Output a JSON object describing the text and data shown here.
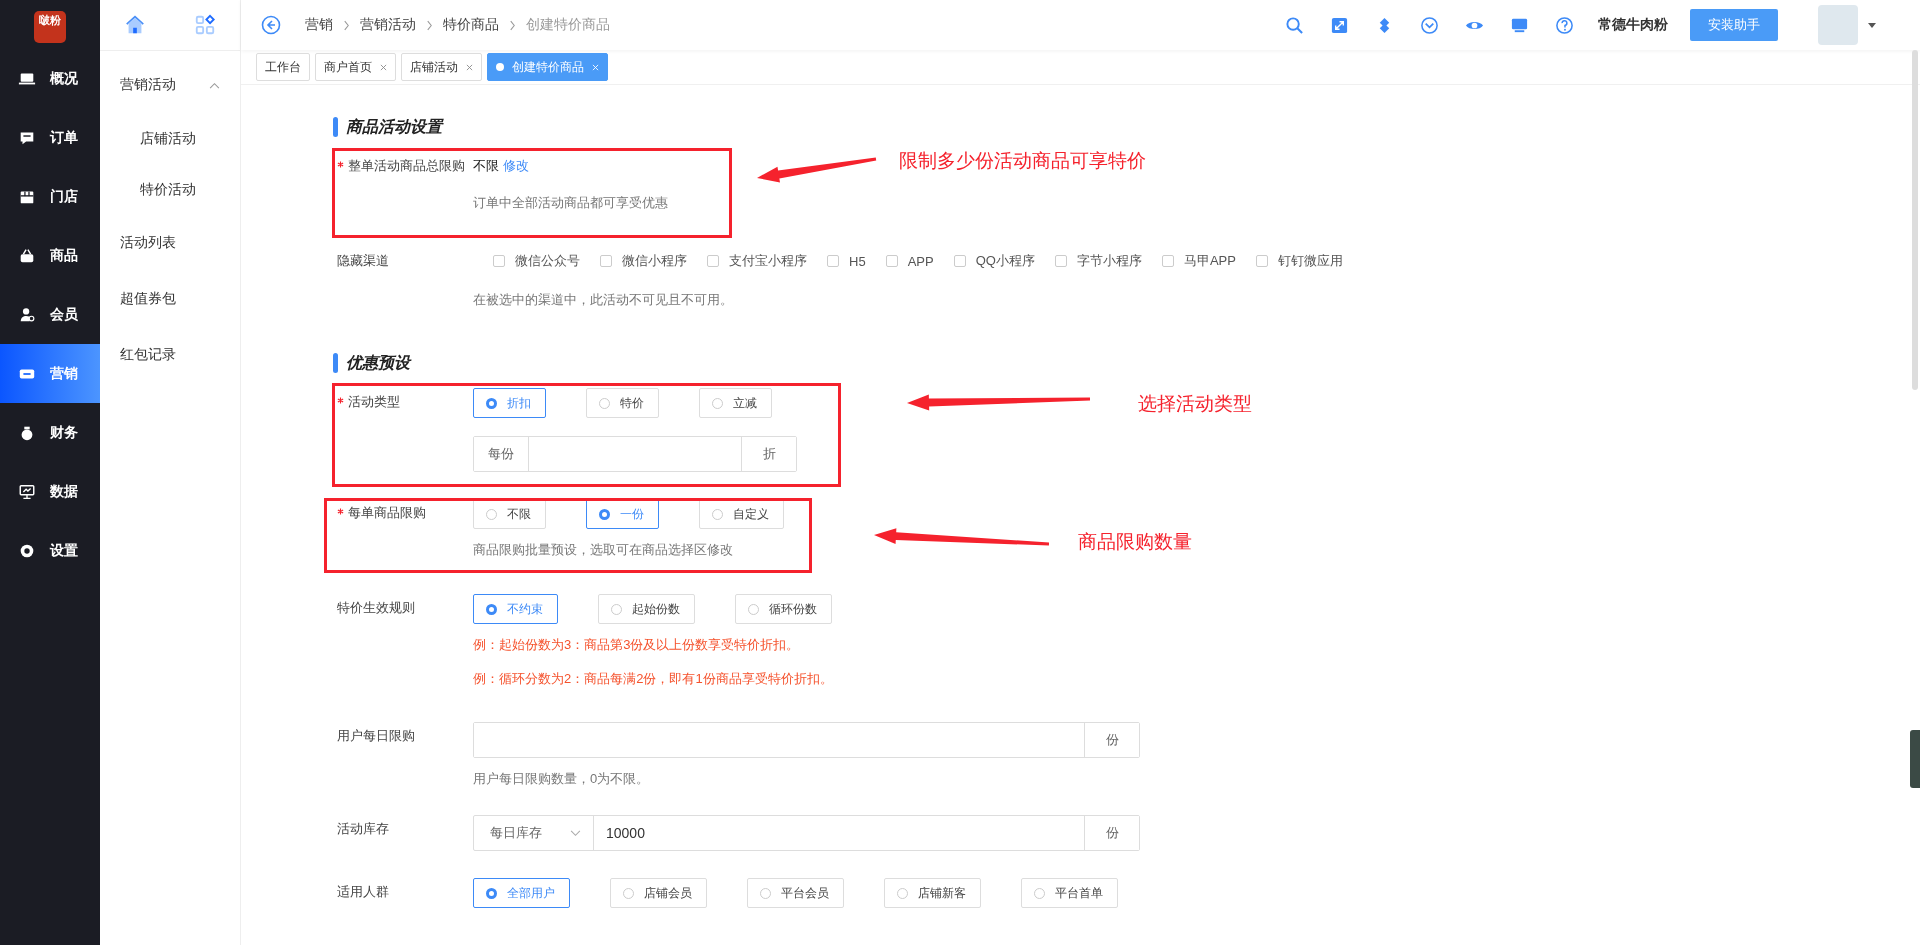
{
  "logo": {
    "text": "啵粉"
  },
  "nav": [
    {
      "label": "概况",
      "selected": false
    },
    {
      "label": "订单",
      "selected": false
    },
    {
      "label": "门店",
      "selected": false
    },
    {
      "label": "商品",
      "selected": false
    },
    {
      "label": "会员",
      "selected": false
    },
    {
      "label": "营销",
      "selected": true
    },
    {
      "label": "财务",
      "selected": false
    },
    {
      "label": "数据",
      "selected": false
    },
    {
      "label": "设置",
      "selected": false
    }
  ],
  "subnav": [
    {
      "label": "营销活动",
      "expanded": true,
      "children": [
        {
          "label": "店铺活动"
        },
        {
          "label": "特价活动"
        }
      ]
    },
    {
      "label": "活动列表"
    },
    {
      "label": "超值券包"
    },
    {
      "label": "红包记录"
    }
  ],
  "breadcrumb": [
    {
      "label": "营销",
      "current": false
    },
    {
      "label": "营销活动",
      "current": false
    },
    {
      "label": "特价商品",
      "current": false
    },
    {
      "label": "创建特价商品",
      "current": true
    }
  ],
  "store_name": "常德牛肉粉",
  "install_button": "安装助手",
  "tabs": [
    {
      "label": "工作台",
      "closable": false,
      "selected": false
    },
    {
      "label": "商户首页",
      "closable": true,
      "selected": false
    },
    {
      "label": "店铺活动",
      "closable": true,
      "selected": false
    },
    {
      "label": "创建特价商品",
      "closable": true,
      "selected": true
    }
  ],
  "sections": [
    {
      "title": "商品活动设置",
      "rows": [
        {
          "kind": "limit",
          "label": "整单活动商品总限购",
          "required": true,
          "value": "不限",
          "link": "修改",
          "hint": "订单中全部活动商品都可享受优惠"
        },
        {
          "kind": "checkboxes",
          "label": "隐藏渠道",
          "required": false,
          "options": [
            {
              "label": "微信公众号",
              "checked": false
            },
            {
              "label": "微信小程序",
              "checked": false
            },
            {
              "label": "支付宝小程序",
              "checked": false
            },
            {
              "label": "H5",
              "checked": false
            },
            {
              "label": "APP",
              "checked": false
            },
            {
              "label": "QQ小程序",
              "checked": false
            },
            {
              "label": "字节小程序",
              "checked": false
            },
            {
              "label": "马甲APP",
              "checked": false
            },
            {
              "label": "钉钉微应用",
              "checked": false
            }
          ],
          "hint": "在被选中的渠道中，此活动不可见且不可用。"
        }
      ]
    },
    {
      "title": "优惠预设",
      "rows": [
        {
          "kind": "radios",
          "label": "活动类型",
          "required": true,
          "options": [
            {
              "label": "折扣",
              "selected": true
            },
            {
              "label": "特价",
              "selected": false
            },
            {
              "label": "立减",
              "selected": false
            }
          ],
          "input": {
            "prefix": "每份",
            "suffix": "折"
          }
        },
        {
          "kind": "radios",
          "label": "每单商品限购",
          "required": true,
          "options": [
            {
              "label": "不限",
              "selected": false
            },
            {
              "label": "一份",
              "selected": true
            },
            {
              "label": "自定义",
              "selected": false
            }
          ],
          "hint": "商品限购批量预设，选取可在商品选择区修改"
        },
        {
          "kind": "radios",
          "label": "特价生效规则",
          "required": false,
          "options": [
            {
              "label": "不约束",
              "selected": true
            },
            {
              "label": "起始份数",
              "selected": false
            },
            {
              "label": "循环份数",
              "selected": false
            }
          ],
          "notes": [
            "例：起始份数为3：商品第3份及以上份数享受特价折扣。",
            "例：循环分数为2：商品每满2份，即有1份商品享受特价折扣。"
          ]
        },
        {
          "kind": "input",
          "label": "用户每日限购",
          "required": false,
          "input": {
            "suffix": "份"
          },
          "hint": "用户每日限购数量，0为不限。"
        },
        {
          "kind": "input",
          "label": "活动库存",
          "required": false,
          "input": {
            "select": "每日库存",
            "value": "10000",
            "suffix": "份"
          }
        },
        {
          "kind": "radios",
          "label": "适用人群",
          "required": false,
          "options": [
            {
              "label": "全部用户",
              "selected": true
            },
            {
              "label": "店铺会员",
              "selected": false
            },
            {
              "label": "平台会员",
              "selected": false
            },
            {
              "label": "店铺新客",
              "selected": false
            },
            {
              "label": "平台首单",
              "selected": false
            }
          ]
        }
      ]
    }
  ],
  "annotations": [
    {
      "text": "限制多少份活动商品可享特价"
    },
    {
      "text": "选择活动类型"
    },
    {
      "text": "商品限购数量"
    }
  ]
}
